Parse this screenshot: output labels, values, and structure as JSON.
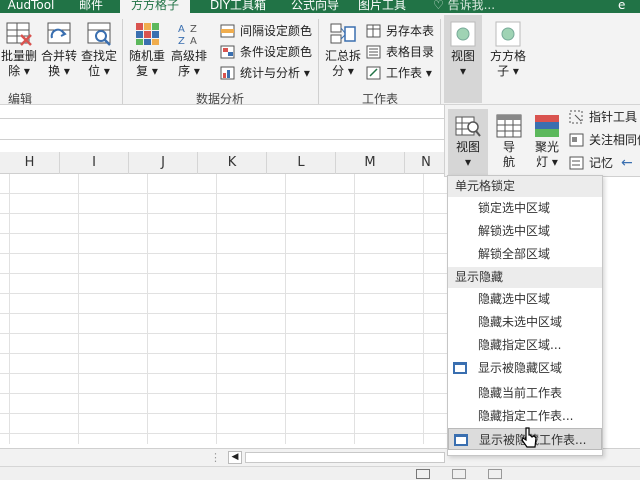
{
  "tabs": [
    {
      "label": "AudTool",
      "active": false
    },
    {
      "label": "邮件",
      "active": false
    },
    {
      "label": "方方格子",
      "active": true
    },
    {
      "label": "DIY工具箱",
      "active": false
    },
    {
      "label": "公式向导",
      "active": false
    },
    {
      "label": "图片工具",
      "active": false
    }
  ],
  "search_text": "告诉我...",
  "tab_right": "е",
  "ribbon": {
    "big_buttons": [
      {
        "line1": "批量删",
        "line2": "除 ▾"
      },
      {
        "line1": "合并转",
        "line2": "换 ▾"
      },
      {
        "line1": "查找定",
        "line2": "位 ▾"
      },
      {
        "line1": "随机重",
        "line2": "复 ▾"
      },
      {
        "line1": "高级排",
        "line2": "序 ▾"
      },
      {
        "line1": "汇总拆",
        "line2": "分 ▾"
      },
      {
        "line1": "视图",
        "line2": "▾"
      },
      {
        "line1": "方方格",
        "line2": "子 ▾"
      }
    ],
    "small_rows": [
      {
        "label": "间隔设定颜色"
      },
      {
        "label": "条件设定颜色"
      },
      {
        "label": "统计与分析 ▾"
      },
      {
        "label": "另存本表"
      },
      {
        "label": "表格目录"
      },
      {
        "label": "工作表 ▾"
      }
    ],
    "groups": [
      "编辑",
      "数据分析",
      "工作表"
    ]
  },
  "columns": [
    "H",
    "I",
    "J",
    "K",
    "L",
    "M",
    "N"
  ],
  "panel": {
    "buttons": [
      {
        "line1": "视图",
        "line2": "▾"
      },
      {
        "line1": "导",
        "line2": "航"
      },
      {
        "line1": "聚光",
        "line2": "灯 ▾"
      }
    ],
    "small": [
      "指针工具",
      "关注相同值",
      "记忆"
    ],
    "arrow": "←"
  },
  "dropdown": {
    "sections": [
      {
        "header": "单元格锁定",
        "items": [
          "锁定选中区域",
          "解锁选中区域",
          "解锁全部区域"
        ]
      },
      {
        "header": "显示隐藏",
        "items": [
          "隐藏选中区域",
          "隐藏未选中区域",
          "隐藏指定区域...",
          "显示被隐藏区域",
          "隐藏当前工作表",
          "隐藏指定工作表...",
          "显示被隐藏工作表..."
        ]
      }
    ]
  },
  "colors": {
    "accent": "#217346",
    "icon_blue": "#3a6fb0",
    "icon_red": "#d9534f"
  }
}
